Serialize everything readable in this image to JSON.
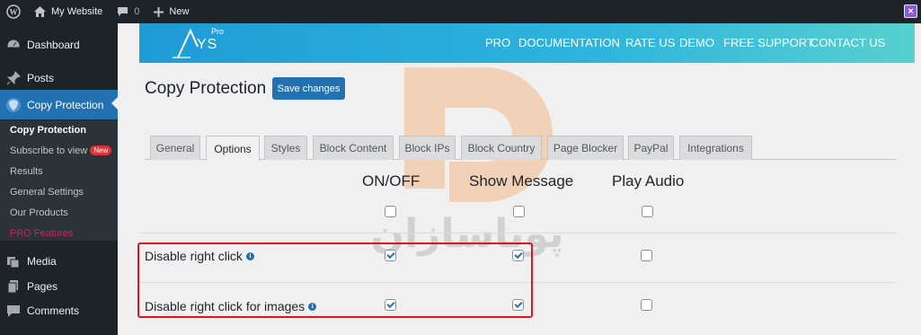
{
  "adminbar": {
    "site_name": "My Website",
    "comments_count": "0",
    "new_label": "New"
  },
  "sidebar": {
    "items": [
      {
        "label": "Dashboard",
        "icon": "dashboard-icon"
      },
      {
        "label": "Posts",
        "icon": "pin-icon"
      },
      {
        "label": "Copy Protection",
        "icon": "shield-icon"
      },
      {
        "label": "Media",
        "icon": "media-icon"
      },
      {
        "label": "Pages",
        "icon": "pages-icon"
      },
      {
        "label": "Comments",
        "icon": "comments-icon"
      }
    ],
    "submenu": [
      {
        "label": "Copy Protection"
      },
      {
        "label": "Subscribe to view",
        "badge": "New"
      },
      {
        "label": "Results"
      },
      {
        "label": "General Settings"
      },
      {
        "label": "Our Products"
      },
      {
        "label": "PRO Features"
      }
    ]
  },
  "brand": {
    "logo_text": "YS",
    "logo_pro": "Pro",
    "nav": [
      "PRO",
      "DOCUMENTATION",
      "RATE US",
      "DEMO",
      "FREE SUPPORT",
      "CONTACT US"
    ]
  },
  "page": {
    "title": "Copy Protection",
    "save_label": "Save changes"
  },
  "tabs": [
    "General",
    "Options",
    "Styles",
    "Block Content",
    "Block IPs",
    "Block Country",
    "Page Blocker",
    "PayPal",
    "Integrations"
  ],
  "active_tab": "Options",
  "columns": [
    "ON/OFF",
    "Show Message",
    "Play Audio"
  ],
  "rows": [
    {
      "label": "",
      "on_off": false,
      "show_message": false,
      "play_audio": false
    },
    {
      "label": "Disable right click",
      "on_off": true,
      "show_message": true,
      "play_audio": false
    },
    {
      "label": "Disable right click for images",
      "on_off": true,
      "show_message": true,
      "play_audio": false
    }
  ],
  "watermark_text": "پویاسازان",
  "colors": {
    "admin_dark": "#1d2327",
    "wp_blue": "#2271b1",
    "highlight_red": "#e0141e",
    "watermark_orange": "#f39a4d"
  }
}
